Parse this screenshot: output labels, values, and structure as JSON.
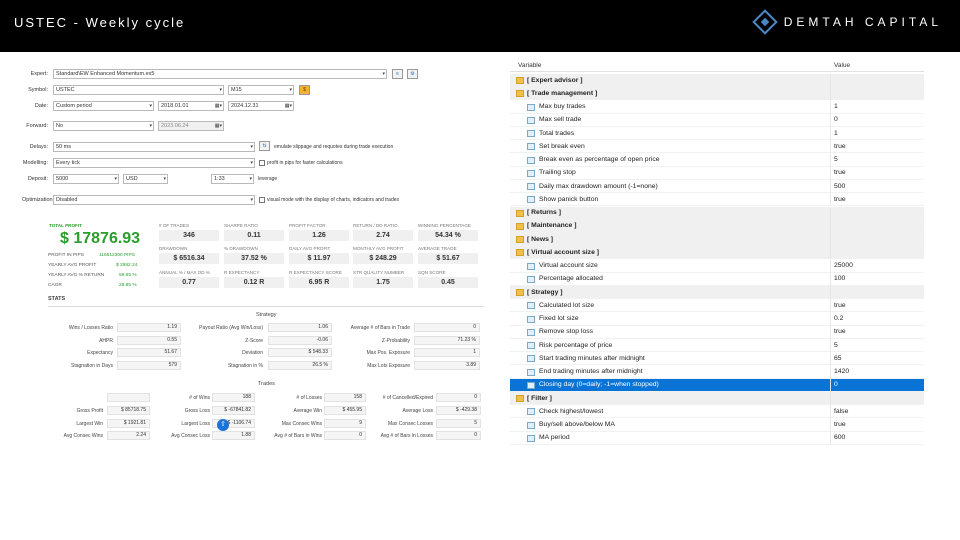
{
  "header": {
    "title": "USTEC - Weekly cycle",
    "brand": "DEMTAH CAPITAL"
  },
  "settings": {
    "expert": {
      "label": "Expert:",
      "value": "Standard\\EW Enhanced Momentum.ex5"
    },
    "symbol": {
      "label": "Symbol:",
      "value": "USTEC",
      "timeframe": "M15"
    },
    "date": {
      "label": "Date:",
      "mode": "Custom period",
      "from": "2018.01.01",
      "to": "2024.12.31"
    },
    "forward": {
      "label": "Forward:",
      "value": "No",
      "date": "2023.06.24"
    },
    "delays": {
      "label": "Delays:",
      "value": "50 ms",
      "note": "emulate slippage and requotes during trade execution"
    },
    "modelling": {
      "label": "Modelling:",
      "value": "Every tick",
      "note": "profit in pips for faster calculations"
    },
    "deposit": {
      "label": "Deposit:",
      "value": "5000",
      "currency": "USD",
      "leverage_value": "1:33",
      "leverage_label": "leverage"
    },
    "optimization": {
      "label": "Optimization:",
      "value": "Disabled",
      "note": "visual mode with the display of charts, indicators and trades"
    }
  },
  "summary": {
    "total_profit_label": "TOTAL PROFIT",
    "total_profit": "$ 17876.93",
    "profit_pips_label": "PROFIT IN PIPS",
    "profit_pips": "116512300 PIPS",
    "yearly_avg_profit_label": "YEARLY AVG PROFIT",
    "yearly_avg_profit": "$ 2982.24",
    "yearly_avg_return_label": "YEARLY AVG % RETURN",
    "yearly_avg_return": "59.65 %",
    "cagr_label": "CAGR",
    "cagr": "28.85 %",
    "kpis": [
      {
        "label": "# OF TRADES",
        "value": "346"
      },
      {
        "label": "SHARPE RATIO",
        "value": "0.11"
      },
      {
        "label": "PROFIT FACTOR",
        "value": "1.26"
      },
      {
        "label": "RETURN / DD RATIO",
        "value": "2.74"
      },
      {
        "label": "WINNING PERCENTAGE",
        "value": "54.34 %"
      },
      {
        "label": "DRAWDOWN",
        "value": "$ 6516.34"
      },
      {
        "label": "% DRAWDOWN",
        "value": "37.52 %"
      },
      {
        "label": "DAILY AVG PROFIT",
        "value": "$ 11.97"
      },
      {
        "label": "MONTHLY AVG PROFIT",
        "value": "$ 248.29"
      },
      {
        "label": "AVERAGE TRADE",
        "value": "$ 51.67"
      },
      {
        "label": "ANNUAL % / MAX DD %",
        "value": "0.77"
      },
      {
        "label": "R EXPECTANCY",
        "value": "0.12 R"
      },
      {
        "label": "R EXPECTANCY SCORE",
        "value": "6.95 R"
      },
      {
        "label": "STR QUALITY NUMBER",
        "value": "1.75"
      },
      {
        "label": "SQN SCORE",
        "value": "0.45"
      }
    ]
  },
  "stats": {
    "title": "STATS",
    "strategy_title": "Strategy",
    "strategy": [
      [
        "Wins / Losses Ratio",
        "1.19",
        "Payout Ratio (Avg Win/Loss)",
        "1.06",
        "Average # of Bars in Trade",
        "0"
      ],
      [
        "AHPR",
        "0.55",
        "Z-Score",
        "-0.06",
        "Z-Probability",
        "71.23 %"
      ],
      [
        "Expectancy",
        "51.67",
        "Deviation",
        "$ 548.33",
        "Max Pos. Exposure",
        "1"
      ],
      [
        "Stagnation in Days",
        "579",
        "Stagnation in %",
        "26.5 %",
        "Max Lots Exposure",
        "3.89"
      ]
    ],
    "trades_title": "Trades",
    "trades": [
      [
        "",
        "",
        "# of Wins",
        "188",
        "# of Losses",
        "158",
        "# of Cancelled/Expired",
        "0"
      ],
      [
        "Gross Profit",
        "$ 85718.75",
        "Gross Loss",
        "$ -67841.82",
        "Average Win",
        "$ 455.95",
        "Average Loss",
        "$ -429.38"
      ],
      [
        "Largest Win",
        "$ 1921.81",
        "Largest Loss",
        "$ -1106.74",
        "Max Consec Wins",
        "9",
        "Max Consec Losses",
        "5"
      ],
      [
        "Avg Consec Wins",
        "2.24",
        "Avg Consec Loss",
        "1.88",
        "Avg # of Bars in Wins",
        "0",
        "Avg # of Bars in Losses",
        "0"
      ]
    ]
  },
  "params": {
    "col_variable": "Variable",
    "col_value": "Value",
    "rows": [
      {
        "type": "group",
        "name": "[ Expert advisor ]",
        "value": ""
      },
      {
        "type": "group",
        "name": "[ Trade management ]",
        "value": ""
      },
      {
        "type": "param",
        "name": "Max buy trades",
        "value": "1"
      },
      {
        "type": "param",
        "name": "Max sell trade",
        "value": "0"
      },
      {
        "type": "param",
        "name": "Total trades",
        "value": "1"
      },
      {
        "type": "param",
        "name": "Set break even",
        "value": "true"
      },
      {
        "type": "param",
        "name": "Break even as percentage of open price",
        "value": "5"
      },
      {
        "type": "param",
        "name": "Trailing stop",
        "value": "true"
      },
      {
        "type": "param",
        "name": "Daily max drawdown amount (-1=none)",
        "value": "500"
      },
      {
        "type": "param",
        "name": "Show panick button",
        "value": "true"
      },
      {
        "type": "group",
        "name": "[ Returns ]",
        "value": ""
      },
      {
        "type": "group",
        "name": "[ Maintenance ]",
        "value": ""
      },
      {
        "type": "group",
        "name": "[ News ]",
        "value": ""
      },
      {
        "type": "group",
        "name": "[ Virtual account size ]",
        "value": ""
      },
      {
        "type": "param",
        "name": "Virtual account size",
        "value": "25000"
      },
      {
        "type": "param",
        "name": "Percentage allocated",
        "value": "100"
      },
      {
        "type": "group",
        "name": "[ Strategy ]",
        "value": ""
      },
      {
        "type": "param",
        "name": "Calculated lot size",
        "value": "true"
      },
      {
        "type": "param",
        "name": "Fixed lot size",
        "value": "0.2"
      },
      {
        "type": "param",
        "name": "Remove stop loss",
        "value": "true"
      },
      {
        "type": "param",
        "name": "Risk percentage of price",
        "value": "5"
      },
      {
        "type": "param",
        "name": "Start trading minutes after midnight",
        "value": "65"
      },
      {
        "type": "param",
        "name": "End trading minutes after midnight",
        "value": "1420"
      },
      {
        "type": "param",
        "name": "Closing day (0=daily; -1=when stopped)",
        "value": "0",
        "selected": true
      },
      {
        "type": "group",
        "name": "[ Filter ]",
        "value": ""
      },
      {
        "type": "param",
        "name": "Check highest/lowest",
        "value": "false"
      },
      {
        "type": "param",
        "name": "Buy/sell above/below MA",
        "value": "true"
      },
      {
        "type": "param",
        "name": "MA period",
        "value": "600"
      }
    ]
  },
  "colors": {
    "profit_green": "#2a9d2a",
    "selection_blue": "#0a74d6",
    "brand_blue": "#4a89c8"
  }
}
